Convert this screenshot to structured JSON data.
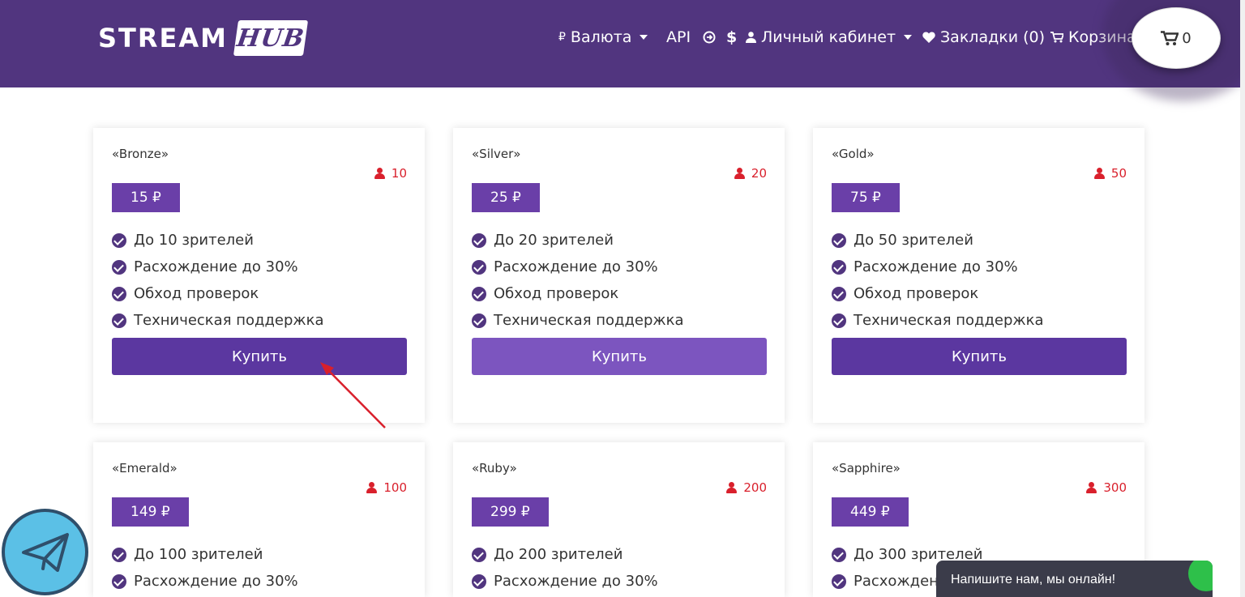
{
  "header": {
    "logo_text": "STREAM",
    "logo_badge": "HUB",
    "nav": {
      "currency_icon": "₽",
      "currency_label": "Валюта",
      "api_label": "API",
      "balance_icon": "$",
      "account_label": "Личный кабинет",
      "bookmarks_label": "Закладки (0)",
      "cart_label": "Корзина"
    },
    "cart_count": "0"
  },
  "plans": [
    {
      "name": "«Bronze»",
      "users": "10",
      "price": "15 ₽",
      "features": [
        "До 10 зрителей",
        "Расхождение до 30%",
        "Обход проверок",
        "Техническая поддержка"
      ],
      "button": "Купить"
    },
    {
      "name": "«Silver»",
      "users": "20",
      "price": "25 ₽",
      "features": [
        "До 20 зрителей",
        "Расхождение до 30%",
        "Обход проверок",
        "Техническая поддержка"
      ],
      "button": "Купить"
    },
    {
      "name": "«Gold»",
      "users": "50",
      "price": "75 ₽",
      "features": [
        "До 50 зрителей",
        "Расхождение до 30%",
        "Обход проверок",
        "Техническая поддержка"
      ],
      "button": "Купить"
    },
    {
      "name": "«Emerald»",
      "users": "100",
      "price": "149 ₽",
      "features": [
        "До 100 зрителей",
        "Расхождение до 30%"
      ]
    },
    {
      "name": "«Ruby»",
      "users": "200",
      "price": "299 ₽",
      "features": [
        "До 200 зрителей",
        "Расхождение до 30%"
      ]
    },
    {
      "name": "«Sapphire»",
      "users": "300",
      "price": "449 ₽",
      "features": [
        "До 300 зрителей",
        "Расхождени"
      ]
    }
  ],
  "chat": {
    "label": "Напишите нам, мы онлайн!"
  },
  "colors": {
    "header": "#51357f",
    "button": "#5b37a0",
    "button_hover": "#7c55bf",
    "price_badge": "#6a3fa8",
    "users": "#d9202c",
    "arrow": "#d9202c",
    "telegram": "#5bc0e6",
    "chat": "#3b3c4a",
    "chat_status": "#2ec04a"
  },
  "icons": {
    "user": "user-icon",
    "check": "check-circle-icon",
    "heart": "heart-icon",
    "cart": "cart-icon",
    "telegram": "telegram-icon",
    "api": "arrow-circle-icon"
  }
}
